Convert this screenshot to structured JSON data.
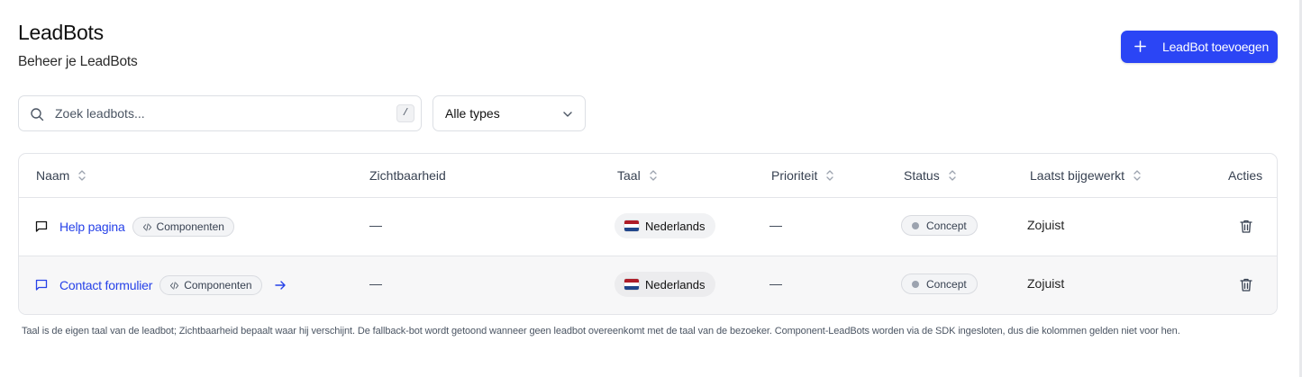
{
  "header": {
    "title": "LeadBots",
    "subtitle": "Beheer je LeadBots",
    "add_button_label": "LeadBot toevoegen"
  },
  "filters": {
    "search_placeholder": "Zoek leadbots...",
    "search_value": "",
    "search_shortcut": "/",
    "type_select_value": "Alle types"
  },
  "table": {
    "columns": {
      "name": "Naam",
      "visibility": "Zichtbaarheid",
      "language": "Taal",
      "priority": "Prioriteit",
      "status": "Status",
      "updated": "Laatst bijgewerkt",
      "actions": "Acties"
    },
    "rows": [
      {
        "name": "Help pagina",
        "badge": "Componenten",
        "visibility": "—",
        "language": "Nederlands",
        "priority": "—",
        "status": "Concept",
        "updated": "Zojuist"
      },
      {
        "name": "Contact formulier",
        "badge": "Componenten",
        "visibility": "—",
        "language": "Nederlands",
        "priority": "—",
        "status": "Concept",
        "updated": "Zojuist"
      }
    ]
  },
  "footnote": "Taal is de eigen taal van de leadbot; Zichtbaarheid bepaalt waar hij verschijnt. De fallback-bot wordt getoond wanneer geen leadbot overeenkomt met de taal van de bezoeker. Component-LeadBots worden via de SDK ingesloten, dus die kolommen gelden niet voor hen.",
  "icons": {
    "add": "plus-icon",
    "search": "search-icon",
    "select": "chevron-down-icon",
    "sort": "sort-icon",
    "chat": "chat-bubble-icon",
    "component": "code-icon",
    "open": "arrow-right-icon",
    "delete": "trash-icon",
    "language_flag": "flag-nl-icon"
  },
  "colors": {
    "primary": "#2b45f5",
    "link": "#2742e8",
    "border": "#e3e5e9",
    "status_dot": "#9ca3af",
    "flag_red": "#ae1c28",
    "flag_white": "#ffffff",
    "flag_blue": "#21468b"
  }
}
